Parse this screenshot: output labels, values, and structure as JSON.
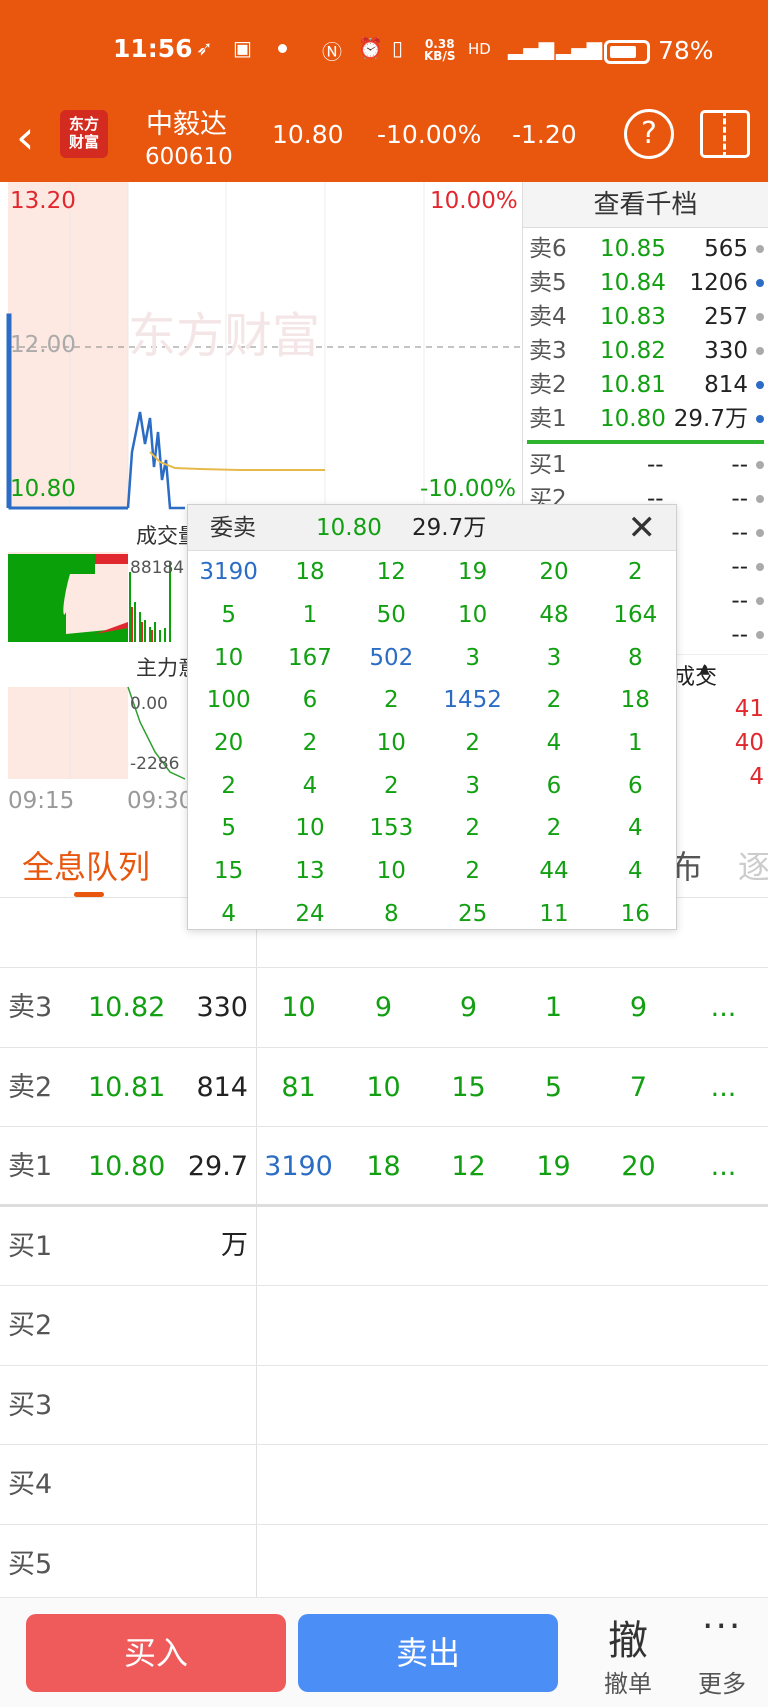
{
  "status_bar": {
    "time": "11:56",
    "net_speed_top": "0.38",
    "net_speed_bottom": "KB/S",
    "battery": "78%"
  },
  "header": {
    "logo_line1": "东方",
    "logo_line2": "财富",
    "stock_name": "中毅达",
    "stock_code": "600610",
    "price": "10.80",
    "change_pct": "-10.00%",
    "change": "-1.20"
  },
  "chart": {
    "price_high": "13.20",
    "pct_high": "10.00%",
    "price_mid": "12.00",
    "price_low": "10.80",
    "pct_low": "-10.00%",
    "watermark": "东方财富",
    "volume_label": "成交量",
    "volume_value": "88184",
    "main_flow_label": "主力意向",
    "flow_top": "0.00",
    "flow_bottom": "-2286",
    "time_start": "09:15",
    "time_open": "09:30"
  },
  "order_book": {
    "title": "查看千档",
    "asks": [
      {
        "label": "卖6",
        "price": "10.85",
        "volume": "565",
        "dot": "gray"
      },
      {
        "label": "卖5",
        "price": "10.84",
        "volume": "1206",
        "dot": "blue"
      },
      {
        "label": "卖4",
        "price": "10.83",
        "volume": "257",
        "dot": "gray"
      },
      {
        "label": "卖3",
        "price": "10.82",
        "volume": "330",
        "dot": "gray"
      },
      {
        "label": "卖2",
        "price": "10.81",
        "volume": "814",
        "dot": "blue"
      },
      {
        "label": "卖1",
        "price": "10.80",
        "volume": "29.7万",
        "dot": "blue"
      }
    ],
    "bids": [
      {
        "label": "买1",
        "price": "--",
        "volume": "--"
      },
      {
        "label": "买2",
        "price": "--",
        "volume": "--"
      }
    ],
    "trades_label": "成交",
    "trades": [
      "41",
      "40",
      "4"
    ]
  },
  "popup": {
    "title": "委卖",
    "price": "10.80",
    "volume": "29.7万",
    "rows": [
      [
        "3190",
        "18",
        "12",
        "19",
        "20",
        "2"
      ],
      [
        "5",
        "1",
        "50",
        "10",
        "48",
        "164"
      ],
      [
        "10",
        "167",
        "502",
        "3",
        "3",
        "8"
      ],
      [
        "100",
        "6",
        "2",
        "1452",
        "2",
        "18"
      ],
      [
        "20",
        "2",
        "10",
        "2",
        "4",
        "1"
      ],
      [
        "2",
        "4",
        "2",
        "3",
        "6",
        "6"
      ],
      [
        "5",
        "10",
        "153",
        "2",
        "2",
        "4"
      ],
      [
        "15",
        "13",
        "10",
        "2",
        "44",
        "4"
      ],
      [
        "4",
        "24",
        "8",
        "25",
        "11",
        "16"
      ]
    ],
    "highlight": [
      "3190",
      "502",
      "1452"
    ]
  },
  "tabs": {
    "active": "全息队列",
    "tab2": "布",
    "tab3": "逐"
  },
  "queue": {
    "asks": [
      {
        "label": "卖3",
        "price": "10.82",
        "volume": "330",
        "orders": [
          "10",
          "9",
          "9",
          "1",
          "9",
          "..."
        ]
      },
      {
        "label": "卖2",
        "price": "10.81",
        "volume": "814",
        "orders": [
          "81",
          "10",
          "15",
          "5",
          "7",
          "..."
        ]
      },
      {
        "label": "卖1",
        "price": "10.80",
        "volume": "29.7万",
        "orders": [
          "3190",
          "18",
          "12",
          "19",
          "20",
          "..."
        ]
      }
    ],
    "bids": [
      "买1",
      "买2",
      "买3",
      "买4",
      "买5"
    ]
  },
  "bottom": {
    "buy": "买入",
    "sell": "卖出",
    "cancel_icon": "撤",
    "cancel": "撤单",
    "more_icon": "···",
    "more": "更多"
  }
}
